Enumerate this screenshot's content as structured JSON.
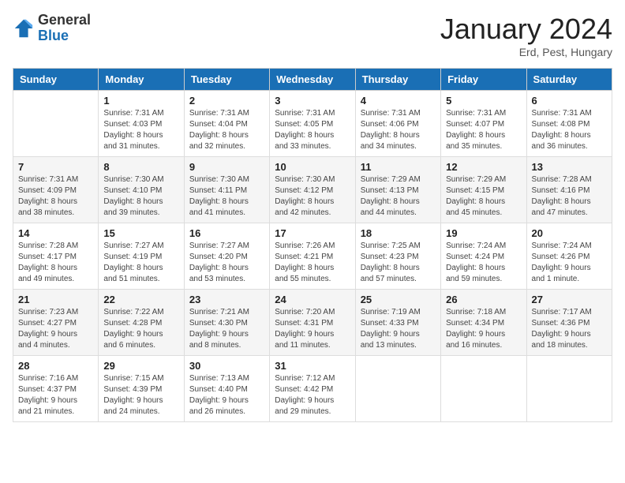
{
  "header": {
    "logo_general": "General",
    "logo_blue": "Blue",
    "month_title": "January 2024",
    "location": "Erd, Pest, Hungary"
  },
  "weekdays": [
    "Sunday",
    "Monday",
    "Tuesday",
    "Wednesday",
    "Thursday",
    "Friday",
    "Saturday"
  ],
  "weeks": [
    [
      {
        "day": "",
        "info": ""
      },
      {
        "day": "1",
        "info": "Sunrise: 7:31 AM\nSunset: 4:03 PM\nDaylight: 8 hours\nand 31 minutes."
      },
      {
        "day": "2",
        "info": "Sunrise: 7:31 AM\nSunset: 4:04 PM\nDaylight: 8 hours\nand 32 minutes."
      },
      {
        "day": "3",
        "info": "Sunrise: 7:31 AM\nSunset: 4:05 PM\nDaylight: 8 hours\nand 33 minutes."
      },
      {
        "day": "4",
        "info": "Sunrise: 7:31 AM\nSunset: 4:06 PM\nDaylight: 8 hours\nand 34 minutes."
      },
      {
        "day": "5",
        "info": "Sunrise: 7:31 AM\nSunset: 4:07 PM\nDaylight: 8 hours\nand 35 minutes."
      },
      {
        "day": "6",
        "info": "Sunrise: 7:31 AM\nSunset: 4:08 PM\nDaylight: 8 hours\nand 36 minutes."
      }
    ],
    [
      {
        "day": "7",
        "info": "Sunrise: 7:31 AM\nSunset: 4:09 PM\nDaylight: 8 hours\nand 38 minutes."
      },
      {
        "day": "8",
        "info": "Sunrise: 7:30 AM\nSunset: 4:10 PM\nDaylight: 8 hours\nand 39 minutes."
      },
      {
        "day": "9",
        "info": "Sunrise: 7:30 AM\nSunset: 4:11 PM\nDaylight: 8 hours\nand 41 minutes."
      },
      {
        "day": "10",
        "info": "Sunrise: 7:30 AM\nSunset: 4:12 PM\nDaylight: 8 hours\nand 42 minutes."
      },
      {
        "day": "11",
        "info": "Sunrise: 7:29 AM\nSunset: 4:13 PM\nDaylight: 8 hours\nand 44 minutes."
      },
      {
        "day": "12",
        "info": "Sunrise: 7:29 AM\nSunset: 4:15 PM\nDaylight: 8 hours\nand 45 minutes."
      },
      {
        "day": "13",
        "info": "Sunrise: 7:28 AM\nSunset: 4:16 PM\nDaylight: 8 hours\nand 47 minutes."
      }
    ],
    [
      {
        "day": "14",
        "info": "Sunrise: 7:28 AM\nSunset: 4:17 PM\nDaylight: 8 hours\nand 49 minutes."
      },
      {
        "day": "15",
        "info": "Sunrise: 7:27 AM\nSunset: 4:19 PM\nDaylight: 8 hours\nand 51 minutes."
      },
      {
        "day": "16",
        "info": "Sunrise: 7:27 AM\nSunset: 4:20 PM\nDaylight: 8 hours\nand 53 minutes."
      },
      {
        "day": "17",
        "info": "Sunrise: 7:26 AM\nSunset: 4:21 PM\nDaylight: 8 hours\nand 55 minutes."
      },
      {
        "day": "18",
        "info": "Sunrise: 7:25 AM\nSunset: 4:23 PM\nDaylight: 8 hours\nand 57 minutes."
      },
      {
        "day": "19",
        "info": "Sunrise: 7:24 AM\nSunset: 4:24 PM\nDaylight: 8 hours\nand 59 minutes."
      },
      {
        "day": "20",
        "info": "Sunrise: 7:24 AM\nSunset: 4:26 PM\nDaylight: 9 hours\nand 1 minute."
      }
    ],
    [
      {
        "day": "21",
        "info": "Sunrise: 7:23 AM\nSunset: 4:27 PM\nDaylight: 9 hours\nand 4 minutes."
      },
      {
        "day": "22",
        "info": "Sunrise: 7:22 AM\nSunset: 4:28 PM\nDaylight: 9 hours\nand 6 minutes."
      },
      {
        "day": "23",
        "info": "Sunrise: 7:21 AM\nSunset: 4:30 PM\nDaylight: 9 hours\nand 8 minutes."
      },
      {
        "day": "24",
        "info": "Sunrise: 7:20 AM\nSunset: 4:31 PM\nDaylight: 9 hours\nand 11 minutes."
      },
      {
        "day": "25",
        "info": "Sunrise: 7:19 AM\nSunset: 4:33 PM\nDaylight: 9 hours\nand 13 minutes."
      },
      {
        "day": "26",
        "info": "Sunrise: 7:18 AM\nSunset: 4:34 PM\nDaylight: 9 hours\nand 16 minutes."
      },
      {
        "day": "27",
        "info": "Sunrise: 7:17 AM\nSunset: 4:36 PM\nDaylight: 9 hours\nand 18 minutes."
      }
    ],
    [
      {
        "day": "28",
        "info": "Sunrise: 7:16 AM\nSunset: 4:37 PM\nDaylight: 9 hours\nand 21 minutes."
      },
      {
        "day": "29",
        "info": "Sunrise: 7:15 AM\nSunset: 4:39 PM\nDaylight: 9 hours\nand 24 minutes."
      },
      {
        "day": "30",
        "info": "Sunrise: 7:13 AM\nSunset: 4:40 PM\nDaylight: 9 hours\nand 26 minutes."
      },
      {
        "day": "31",
        "info": "Sunrise: 7:12 AM\nSunset: 4:42 PM\nDaylight: 9 hours\nand 29 minutes."
      },
      {
        "day": "",
        "info": ""
      },
      {
        "day": "",
        "info": ""
      },
      {
        "day": "",
        "info": ""
      }
    ]
  ]
}
